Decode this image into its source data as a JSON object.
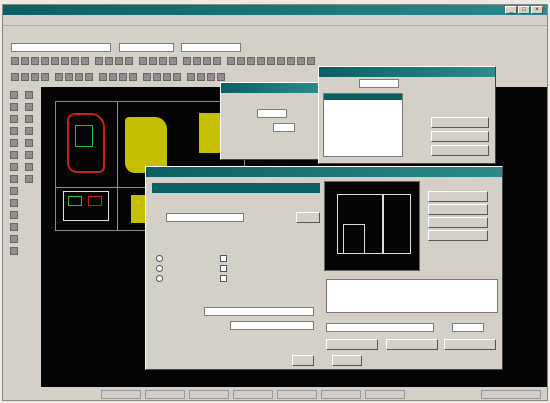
{
  "window": {
    "title": "",
    "controls": [
      "_",
      "□",
      "×"
    ]
  },
  "toolbar_top": {
    "combo1": "",
    "combo2": "",
    "combo3": ""
  },
  "dialog_small": {
    "title": "",
    "rows": [
      "",
      ""
    ],
    "buttons": [
      "",
      ""
    ]
  },
  "dialog_list": {
    "title": "",
    "items": [
      "",
      "",
      "",
      "",
      "",
      "",
      ""
    ],
    "selected_index": 5,
    "buttons": [
      "",
      "",
      ""
    ]
  },
  "dialog_main": {
    "title": "",
    "tab": "",
    "field1": "",
    "group1_title": "",
    "radios": [
      "",
      "",
      ""
    ],
    "checks": [
      "",
      "",
      ""
    ],
    "group2_title": "",
    "field2_label": "",
    "field2": "",
    "field3_label": "",
    "field3": "",
    "side_buttons": [
      "",
      "",
      "",
      ""
    ],
    "preview_label": "",
    "scale_label": "",
    "info_lines": [
      "",
      "",
      ""
    ],
    "bottom_buttons": [
      "",
      "",
      ""
    ],
    "ok": "",
    "cancel": ""
  },
  "status_bar": {
    "cells": [
      "",
      "",
      "",
      "",
      "",
      "",
      "",
      ""
    ]
  },
  "colors": {
    "accent": "#0a5f62",
    "cad_background": "#050505",
    "cad_yellow": "#d9d400"
  }
}
